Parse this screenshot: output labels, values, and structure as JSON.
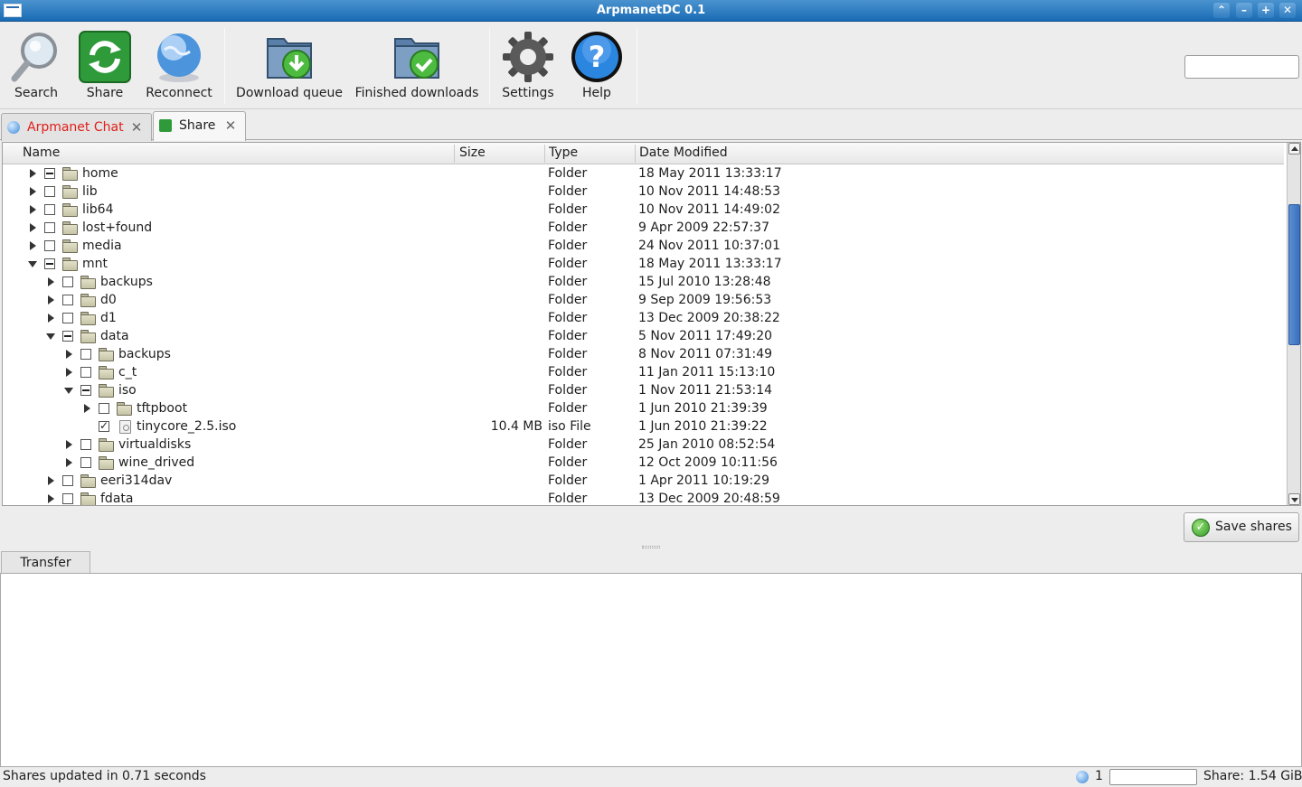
{
  "window": {
    "title": "ArpmanetDC 0.1"
  },
  "toolbar": {
    "buttons": [
      {
        "label": "Search",
        "icon": "magnifier-icon"
      },
      {
        "label": "Share",
        "icon": "share-icon"
      },
      {
        "label": "Reconnect",
        "icon": "globe-icon"
      },
      {
        "label": "Download queue",
        "icon": "download-queue-icon"
      },
      {
        "label": "Finished downloads",
        "icon": "finished-downloads-icon"
      },
      {
        "label": "Settings",
        "icon": "gear-icon"
      },
      {
        "label": "Help",
        "icon": "help-icon"
      }
    ],
    "search_value": ""
  },
  "tabs": [
    {
      "label": "Arpmanet Chat",
      "color": "#e0201b"
    },
    {
      "label": "Share",
      "color": "#1e1e1e"
    }
  ],
  "tree": {
    "columns": [
      "Name",
      "Size",
      "Type",
      "Date Modified"
    ],
    "rows": [
      {
        "name": "home",
        "size": "",
        "type": "Folder",
        "date": "18 May 2011 13:33:17",
        "depth": 0,
        "expand": "closed",
        "check": "partial",
        "kind": "folder"
      },
      {
        "name": "lib",
        "size": "",
        "type": "Folder",
        "date": "10 Nov 2011 14:48:53",
        "depth": 0,
        "expand": "closed",
        "check": "none",
        "kind": "folder"
      },
      {
        "name": "lib64",
        "size": "",
        "type": "Folder",
        "date": "10 Nov 2011 14:49:02",
        "depth": 0,
        "expand": "closed",
        "check": "none",
        "kind": "folder"
      },
      {
        "name": "lost+found",
        "size": "",
        "type": "Folder",
        "date": "9 Apr 2009 22:57:37",
        "depth": 0,
        "expand": "closed",
        "check": "none",
        "kind": "folder"
      },
      {
        "name": "media",
        "size": "",
        "type": "Folder",
        "date": "24 Nov 2011 10:37:01",
        "depth": 0,
        "expand": "closed",
        "check": "none",
        "kind": "folder"
      },
      {
        "name": "mnt",
        "size": "",
        "type": "Folder",
        "date": "18 May 2011 13:33:17",
        "depth": 0,
        "expand": "open",
        "check": "partial",
        "kind": "folder"
      },
      {
        "name": "backups",
        "size": "",
        "type": "Folder",
        "date": "15 Jul 2010 13:28:48",
        "depth": 1,
        "expand": "closed",
        "check": "none",
        "kind": "folder"
      },
      {
        "name": "d0",
        "size": "",
        "type": "Folder",
        "date": "9 Sep 2009 19:56:53",
        "depth": 1,
        "expand": "closed",
        "check": "none",
        "kind": "folder"
      },
      {
        "name": "d1",
        "size": "",
        "type": "Folder",
        "date": "13 Dec 2009 20:38:22",
        "depth": 1,
        "expand": "closed",
        "check": "none",
        "kind": "folder"
      },
      {
        "name": "data",
        "size": "",
        "type": "Folder",
        "date": "5 Nov 2011 17:49:20",
        "depth": 1,
        "expand": "open",
        "check": "partial",
        "kind": "folder"
      },
      {
        "name": "backups",
        "size": "",
        "type": "Folder",
        "date": "8 Nov 2011 07:31:49",
        "depth": 2,
        "expand": "closed",
        "check": "none",
        "kind": "folder"
      },
      {
        "name": "c_t",
        "size": "",
        "type": "Folder",
        "date": "11 Jan 2011 15:13:10",
        "depth": 2,
        "expand": "closed",
        "check": "none",
        "kind": "folder"
      },
      {
        "name": "iso",
        "size": "",
        "type": "Folder",
        "date": "1 Nov 2011 21:53:14",
        "depth": 2,
        "expand": "open",
        "check": "partial",
        "kind": "folder"
      },
      {
        "name": "tftpboot",
        "size": "",
        "type": "Folder",
        "date": "1 Jun 2010 21:39:39",
        "depth": 3,
        "expand": "closed",
        "check": "none",
        "kind": "folder"
      },
      {
        "name": "tinycore_2.5.iso",
        "size": "10.4 MB",
        "type": "iso File",
        "date": "1 Jun 2010 21:39:22",
        "depth": 3,
        "expand": "",
        "check": "checked",
        "kind": "file"
      },
      {
        "name": "virtualdisks",
        "size": "",
        "type": "Folder",
        "date": "25 Jan 2010 08:52:54",
        "depth": 2,
        "expand": "closed",
        "check": "none",
        "kind": "folder"
      },
      {
        "name": "wine_drived",
        "size": "",
        "type": "Folder",
        "date": "12 Oct 2009 10:11:56",
        "depth": 2,
        "expand": "closed",
        "check": "none",
        "kind": "folder"
      },
      {
        "name": "eeri314dav",
        "size": "",
        "type": "Folder",
        "date": "1 Apr 2011 10:19:29",
        "depth": 1,
        "expand": "closed",
        "check": "none",
        "kind": "folder"
      },
      {
        "name": "fdata",
        "size": "",
        "type": "Folder",
        "date": "13 Dec 2009 20:48:59",
        "depth": 1,
        "expand": "closed",
        "check": "none",
        "kind": "folder"
      }
    ]
  },
  "actions": {
    "save_label": "Save shares"
  },
  "transfer": {
    "tab_label": "Transfer"
  },
  "statusbar": {
    "message": "Shares updated in 0.71 seconds",
    "peer_count": "1",
    "share_total": "Share: 1.54 GiB"
  }
}
